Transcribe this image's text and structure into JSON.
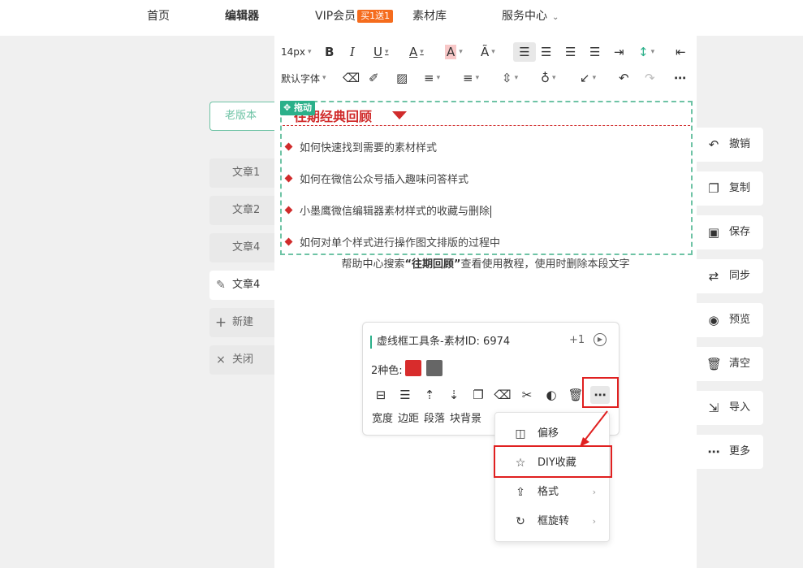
{
  "nav": {
    "home": "首页",
    "editor": "编辑器",
    "vip": "VIP会员",
    "vip_badge": "买1送1",
    "materials": "素材库",
    "service": "服务中心"
  },
  "toolbar": {
    "font_size": "14px",
    "font_family": "默认字体"
  },
  "content": {
    "drag_label": "拖动",
    "title": "往期经典回顾",
    "items": [
      "如何快速找到需要的素材样式",
      "如何在微信公众号插入趣味问答样式",
      "小墨鹰微信编辑器素材样式的收藏与删除",
      "如何对单个样式进行操作图文排版的过程中"
    ],
    "help_prefix": "帮助中心搜索",
    "help_keyword": "“往期回顾”",
    "help_suffix": "查看使用教程，使用时删除本段文字"
  },
  "sidebar": {
    "old_version": "老版本",
    "items": [
      {
        "label": "文章1"
      },
      {
        "label": "文章2"
      },
      {
        "label": "文章4"
      },
      {
        "label": "文章4"
      }
    ],
    "new_label": "新建",
    "close_label": "关闭"
  },
  "actions": [
    {
      "label": "撤销",
      "icon": "undo-icon"
    },
    {
      "label": "复制",
      "icon": "copy-icon"
    },
    {
      "label": "保存",
      "icon": "save-icon"
    },
    {
      "label": "同步",
      "icon": "sync-icon"
    },
    {
      "label": "预览",
      "icon": "eye-icon"
    },
    {
      "label": "清空",
      "icon": "trash-icon"
    },
    {
      "label": "导入",
      "icon": "import-icon"
    },
    {
      "label": "更多",
      "icon": "more-icon"
    }
  ],
  "popup": {
    "title": "虚线框工具条-素材ID: 6974",
    "version": "+1",
    "colors_label": "2种色:",
    "colors": [
      "#d82c2c",
      "#666666"
    ],
    "labels": [
      "宽度",
      "边距",
      "段落",
      "块背景"
    ]
  },
  "menu": {
    "items": [
      {
        "label": "偏移"
      },
      {
        "label": "DIY收藏"
      },
      {
        "label": "格式",
        "arrow": "›"
      },
      {
        "label": "框旋转",
        "arrow": "›"
      }
    ]
  },
  "colors": {
    "accent": "#2bb08a",
    "title_red": "#d02b2b",
    "highlight": "#e02020"
  }
}
